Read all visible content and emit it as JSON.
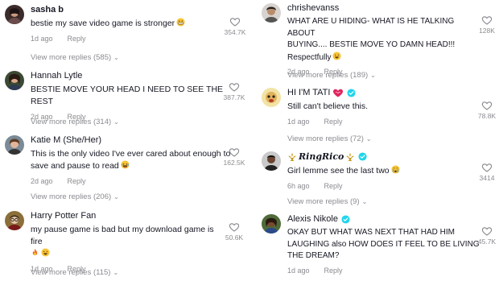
{
  "meta_labels": {
    "reply": "Reply"
  },
  "colors": {
    "text": "#161823",
    "muted": "#8a8b91",
    "verified": "#20d5ec",
    "heart_badge": "#e0245e"
  },
  "left_comments": [
    {
      "username": "sasha b",
      "text": "bestie my save video game is stronger",
      "emoji": "grimacing",
      "age": "1d ago",
      "likes": "354.7K",
      "replies": "View more replies (585)"
    },
    {
      "username": "Hannah Lytle",
      "text": "BESTIE MOVE YOUR HEAD I NEED TO SEE THE REST",
      "age": "2d ago",
      "likes": "387.7K",
      "replies": "View more replies (314)"
    },
    {
      "username": "Katie M (She/Her)",
      "text_line1": "This is the only video I've ever cared about enough to",
      "text_line2": "save and pause to read",
      "emoji": "laughing",
      "age": "2d ago",
      "likes": "162.5K",
      "replies": "View more replies (206)"
    },
    {
      "username": "Harry Potter Fan",
      "text": "my pause game is bad but my download game is fire",
      "age": "1d ago",
      "likes": "50.6K",
      "replies": "View more replies (115)"
    }
  ],
  "right_comments": [
    {
      "username": "chrishevanss",
      "text_line1": "WHAT ARE U HIDING- WHAT IS HE TALKING ABOUT",
      "text_line2": "BUYING.... BESTIE MOVE YO DAMN HEAD!!!",
      "text_line3": "Respectfully",
      "age": "2d ago",
      "likes": "128K",
      "replies": "View more replies (189)"
    },
    {
      "username": "HI I'M TATI",
      "text": "Still can't believe this.",
      "age": "1d ago",
      "likes": "78.8K",
      "replies": "View more replies (72)"
    },
    {
      "username": "RingRico",
      "text": "Girl lemme see the last two",
      "age": "6h ago",
      "likes": "3414",
      "replies": "View more replies (9)"
    },
    {
      "username": "Alexis Nikole",
      "text_line1": "OKAY BUT WHAT WAS NEXT THAT HAD HIM",
      "text_line2": "LAUGHING also HOW DOES IT FEEL TO BE LIVING",
      "text_line3": "THE DREAM?",
      "age": "1d ago",
      "likes": "45.7K"
    }
  ]
}
